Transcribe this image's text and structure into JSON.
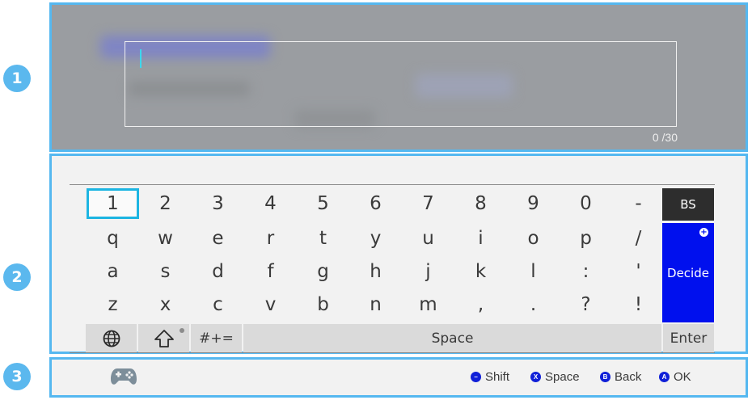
{
  "callouts": [
    "1",
    "2",
    "3"
  ],
  "input": {
    "value": "",
    "counter": "0 /30"
  },
  "keyboard": {
    "rows": [
      [
        "1",
        "2",
        "3",
        "4",
        "5",
        "6",
        "7",
        "8",
        "9",
        "0",
        "-"
      ],
      [
        "q",
        "w",
        "e",
        "r",
        "t",
        "y",
        "u",
        "i",
        "o",
        "p",
        "/"
      ],
      [
        "a",
        "s",
        "d",
        "f",
        "g",
        "h",
        "j",
        "k",
        "l",
        ":",
        "'"
      ],
      [
        "z",
        "x",
        "c",
        "v",
        "b",
        "n",
        "m",
        ",",
        ".",
        "?",
        "!"
      ]
    ],
    "selected_key": "1",
    "bs_label": "BS",
    "decide_label": "Decide",
    "decide_badge": "+",
    "symbols_label": "#+=",
    "space_label": "Space",
    "enter_label": "Enter"
  },
  "footer": {
    "controller_icon": "gamepad-icon",
    "legend": [
      {
        "button": "−",
        "label": "Shift"
      },
      {
        "button": "X",
        "label": "Space"
      },
      {
        "button": "B",
        "label": "Back"
      },
      {
        "button": "A",
        "label": "OK"
      }
    ]
  },
  "colors": {
    "highlight_border": "#55b8f0",
    "selection": "#1cb5e2",
    "decide": "#0010ee",
    "bs": "#2d2d2d",
    "callout": "#5bb8ee"
  }
}
